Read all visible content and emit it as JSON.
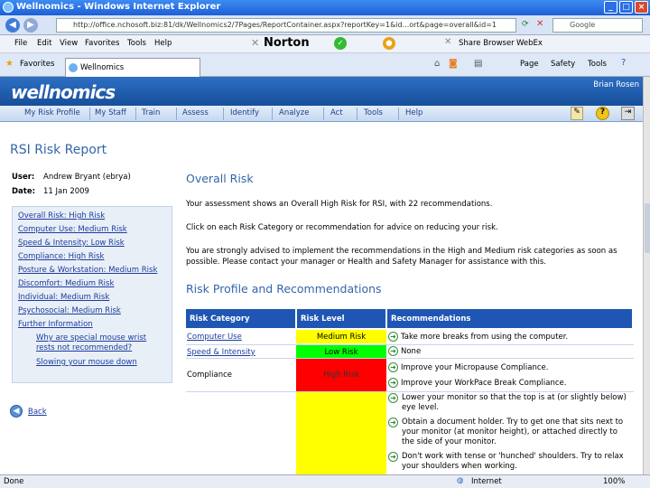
{
  "window": {
    "title": "Wellnomics - Windows Internet Explorer",
    "min": "_",
    "max": "□",
    "close": "×"
  },
  "browser": {
    "url": "http://office.nchosoft.biz:81/dk/Wellnomics2/7Pages/ReportContainer.aspx?reportKey=1&id...ort&page=overall&id=1",
    "search_placeholder": "Google",
    "menu": [
      "File",
      "Edit",
      "View",
      "Favorites",
      "Tools",
      "Help"
    ],
    "norton": "Norton",
    "share": "Share Browser",
    "webex": "WebEx",
    "favorites": "Favorites",
    "tab": "Wellnomics",
    "tools_right": [
      "Page",
      "Safety",
      "Tools"
    ]
  },
  "site": {
    "logo": "wellnomics",
    "user": "Brian Rosen",
    "nav": [
      "My Risk Profile",
      "My Staff",
      "Train",
      "Assess",
      "Identify",
      "Analyze",
      "Act",
      "Tools",
      "Help"
    ]
  },
  "report": {
    "title": "RSI Risk Report",
    "user_label": "User:",
    "user_value": "Andrew Bryant (ebrya)",
    "date_label": "Date:",
    "date_value": "11 Jan 2009",
    "sidebar": [
      "Overall Risk: High Risk",
      "Computer Use: Medium Risk",
      "Speed & Intensity: Low Risk",
      "Compliance: High Risk",
      "Posture & Workstation: Medium Risk",
      "Discomfort: Medium Risk",
      "Individual: Medium Risk",
      "Psychosocial: Medium Risk",
      "Further Information"
    ],
    "sub_links": [
      "Why are special mouse wrist rests not recommended?",
      "Slowing your mouse down"
    ],
    "back": "Back",
    "overall_heading": "Overall Risk",
    "p1": "Your assessment shows an Overall High Risk for RSI, with 22 recommendations.",
    "p2": "Click on each Risk Category or recommendation for advice on reducing your risk.",
    "p3a": "You are strongly advised to implement the recommendations in the High and Medium risk categories as soon as",
    "p3b": "possible. Please contact your manager or Health and Safety Manager for assistance with this.",
    "profile_heading": "Risk Profile and Recommendations",
    "table_headers": [
      "Risk Category",
      "Risk Level",
      "Recommendations"
    ],
    "rows": [
      {
        "category": "Computer Use",
        "level": "Medium Risk",
        "color": "#ffff00",
        "recs": [
          "Take more breaks from using the computer."
        ]
      },
      {
        "category": "Speed & Intensity",
        "level": "Low Risk",
        "color": "#00ff00",
        "recs": [
          "None"
        ]
      },
      {
        "category": "Compliance",
        "level": "High Risk",
        "color": "#ff0000",
        "recs": [
          "Improve your Micropause Compliance.",
          "Improve your WorkPace Break Compliance."
        ]
      },
      {
        "category": "",
        "level": "",
        "color": "#ffff00",
        "recs": [
          "Lower your monitor so that the top is at (or slightly below) eye level.",
          "Obtain a document holder. Try to get one that sits next to your monitor (at monitor height), or attached directly to the side of your monitor.",
          "Don't work with tense or 'hunched' shoulders. Try to relax your shoulders when working."
        ]
      }
    ]
  },
  "status": {
    "left": "Done",
    "zone": "Internet",
    "zoom": "100%"
  }
}
